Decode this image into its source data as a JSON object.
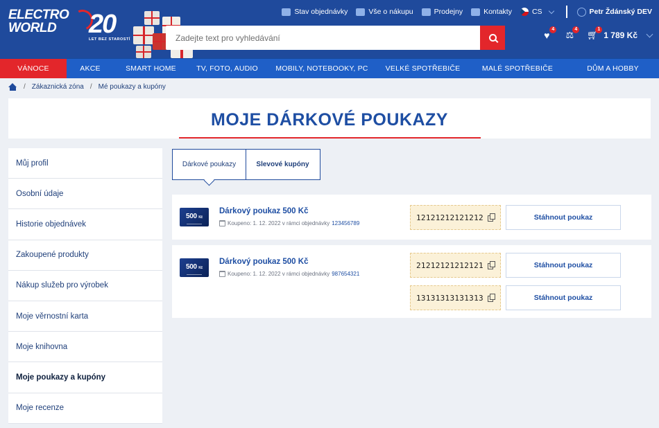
{
  "header": {
    "logo_line1": "ELECTRO",
    "logo_line2": "WORLD",
    "logo_number": "20",
    "logo_slogan": "LET BEZ STAROSTÍ",
    "top_links": [
      {
        "label": "Stav objednávky",
        "icon": "box-icon"
      },
      {
        "label": "Vše o nákupu",
        "icon": "info-cart-icon"
      },
      {
        "label": "Prodejny",
        "icon": "store-icon"
      },
      {
        "label": "Kontakty",
        "icon": "mail-icon"
      }
    ],
    "language": "CS",
    "user_name": "Petr Ždánský DEV",
    "search_placeholder": "Zadejte text pro vyhledávání",
    "wishlist_count": "4",
    "compare_count": "4",
    "cart_count": "1",
    "cart_total": "1 789 Kč"
  },
  "nav": {
    "items": [
      "VÁNOCE",
      "AKCE",
      "SMART HOME",
      "TV, FOTO, AUDIO",
      "MOBILY, NOTEBOOKY, PC",
      "VELKÉ SPOTŘEBIČE",
      "MALÉ SPOTŘEBIČE",
      "DŮM A HOBBY"
    ]
  },
  "breadcrumb": {
    "sep": "/",
    "items": [
      "Zákaznická zóna",
      "Mé poukazy a kupóny"
    ]
  },
  "page": {
    "title": "MOJE DÁRKOVÉ POUKAZY"
  },
  "sidebar": {
    "items": [
      "Můj profil",
      "Osobní údaje",
      "Historie objednávek",
      "Zakoupené produkty",
      "Nákup služeb pro výrobek",
      "Moje věrnostní karta",
      "Moje knihovna",
      "Moje poukazy a kupóny",
      "Moje recenze"
    ],
    "active": "Moje poukazy a kupóny"
  },
  "tabs": {
    "gift": "Dárkové poukazy",
    "discount": "Slevové kupóny"
  },
  "vouchers": [
    {
      "thumb_amount": "500",
      "thumb_currency": "Kč",
      "title": "Dárkový poukaz 500 Kč",
      "meta": "Koupeno: 1. 12. 2022 v rámci objednávky",
      "order": "123456789",
      "codes": [
        "12121212121212"
      ],
      "download_label": "Stáhnout poukaz"
    },
    {
      "thumb_amount": "500",
      "thumb_currency": "Kč",
      "title": "Dárkový poukaz 500 Kč",
      "meta": "Koupeno: 1. 12. 2022 v rámci objednávky",
      "order": "987654321",
      "codes": [
        "21212121212121",
        "13131313131313"
      ],
      "download_label": "Stáhnout poukaz"
    }
  ],
  "colors": {
    "brand_blue": "#1f4a9c",
    "nav_blue": "#1f5fc7",
    "accent_red": "#e3262b",
    "code_bg": "#fbf1d8"
  }
}
